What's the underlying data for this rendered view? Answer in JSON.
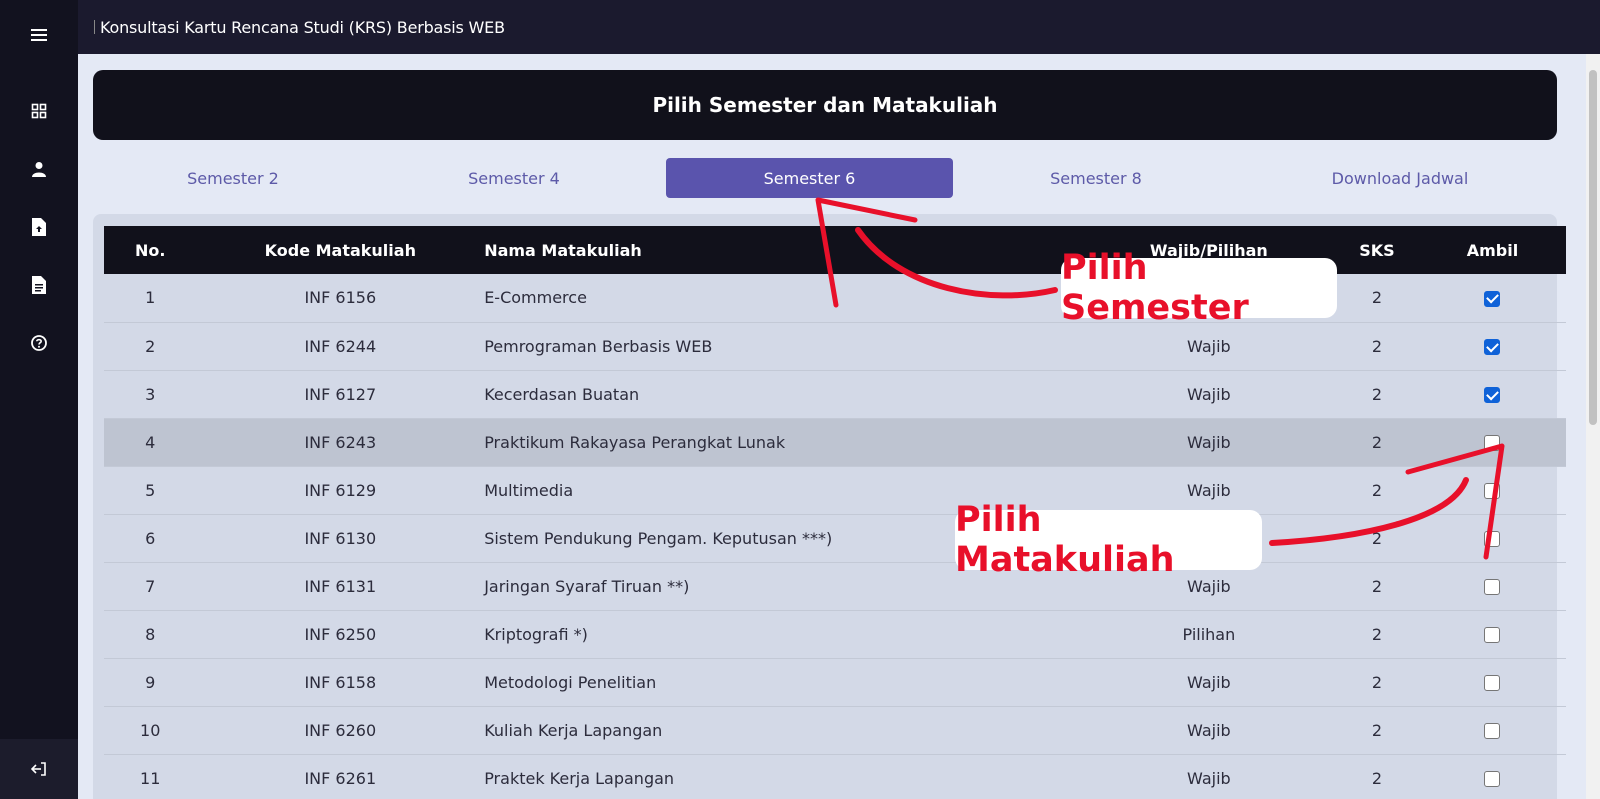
{
  "app": {
    "title": "Konsultasi Kartu Rencana Studi (KRS) Berbasis WEB"
  },
  "sidebar": {
    "icons": [
      "menu-icon",
      "dashboard-icon",
      "user-icon",
      "file-upload-icon",
      "document-icon",
      "help-icon"
    ],
    "logout_icon": "logout-icon"
  },
  "header": {
    "title": "Pilih Semester dan Matakuliah"
  },
  "tabs": [
    {
      "label": "Semester 2",
      "active": false
    },
    {
      "label": "Semester 4",
      "active": false
    },
    {
      "label": "Semester 6",
      "active": true
    },
    {
      "label": "Semester 8",
      "active": false
    },
    {
      "label": "Download Jadwal",
      "active": false
    }
  ],
  "table": {
    "headers": {
      "no": "No.",
      "kode": "Kode Matakuliah",
      "nama": "Nama Matakuliah",
      "wajib": "Wajib/Pilihan",
      "sks": "SKS",
      "ambil": "Ambil"
    },
    "rows": [
      {
        "no": "1",
        "kode": "INF 6156",
        "nama": "E-Commerce",
        "wajib": "",
        "sks": "2",
        "checked": true
      },
      {
        "no": "2",
        "kode": "INF 6244",
        "nama": "Pemrograman Berbasis WEB",
        "wajib": "Wajib",
        "sks": "2",
        "checked": true
      },
      {
        "no": "3",
        "kode": "INF 6127",
        "nama": "Kecerdasan Buatan",
        "wajib": "Wajib",
        "sks": "2",
        "checked": true
      },
      {
        "no": "4",
        "kode": "INF 6243",
        "nama": "Praktikum Rakayasa Perangkat Lunak",
        "wajib": "Wajib",
        "sks": "2",
        "checked": false
      },
      {
        "no": "5",
        "kode": "INF 6129",
        "nama": "Multimedia",
        "wajib": "Wajib",
        "sks": "2",
        "checked": false
      },
      {
        "no": "6",
        "kode": "INF 6130",
        "nama": "Sistem Pendukung Pengam. Keputusan ***)",
        "wajib": "",
        "sks": "2",
        "checked": false
      },
      {
        "no": "7",
        "kode": "INF 6131",
        "nama": "Jaringan Syaraf Tiruan **)",
        "wajib": "Wajib",
        "sks": "2",
        "checked": false
      },
      {
        "no": "8",
        "kode": "INF 6250",
        "nama": "Kriptografi *)",
        "wajib": "Pilihan",
        "sks": "2",
        "checked": false
      },
      {
        "no": "9",
        "kode": "INF 6158",
        "nama": "Metodologi Penelitian",
        "wajib": "Wajib",
        "sks": "2",
        "checked": false
      },
      {
        "no": "10",
        "kode": "INF 6260",
        "nama": "Kuliah Kerja Lapangan",
        "wajib": "Wajib",
        "sks": "2",
        "checked": false
      },
      {
        "no": "11",
        "kode": "INF 6261",
        "nama": "Praktek Kerja Lapangan",
        "wajib": "Wajib",
        "sks": "2",
        "checked": false
      }
    ],
    "highlighted_row": 3
  },
  "annotations": {
    "semester_callout": "Pilih Semester",
    "course_callout": "Pilih Matakuliah",
    "arrow_color": "#e8102a"
  }
}
